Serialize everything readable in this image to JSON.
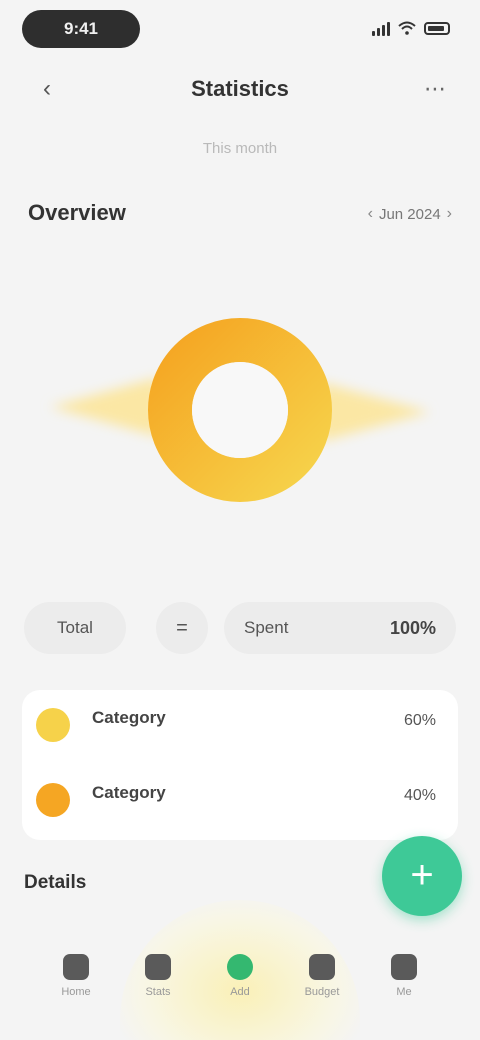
{
  "status_bar": {
    "time": "9:41"
  },
  "header": {
    "back_icon": "chevron-left-icon",
    "title": "Statistics",
    "more_icon": "more-icon"
  },
  "subtitle": "This month",
  "overview": {
    "label": "Overview",
    "date": "Jun 2024"
  },
  "chart": {
    "type": "donut",
    "colors": {
      "primary": "#f4c230",
      "secondary": "#f5a623",
      "glow": "#fbe7a4"
    }
  },
  "metrics": {
    "left_label": "Total",
    "middle_symbol": "=",
    "right_label": "Spent",
    "right_value": "100%"
  },
  "breakdown": [
    {
      "label": "Category",
      "sub": "",
      "value": "60%",
      "color": "#f6d24a"
    },
    {
      "label": "Category",
      "sub": "",
      "value": "40%",
      "color": "#f5a623"
    }
  ],
  "section": {
    "label": "Details"
  },
  "fab": {
    "label": "+"
  },
  "nav": {
    "items": [
      {
        "label": "Home",
        "icon": "home-icon"
      },
      {
        "label": "Stats",
        "icon": "chart-icon"
      },
      {
        "label": "Add",
        "icon": "plus-icon"
      },
      {
        "label": "Budget",
        "icon": "wallet-icon"
      },
      {
        "label": "Me",
        "icon": "user-icon"
      }
    ]
  }
}
